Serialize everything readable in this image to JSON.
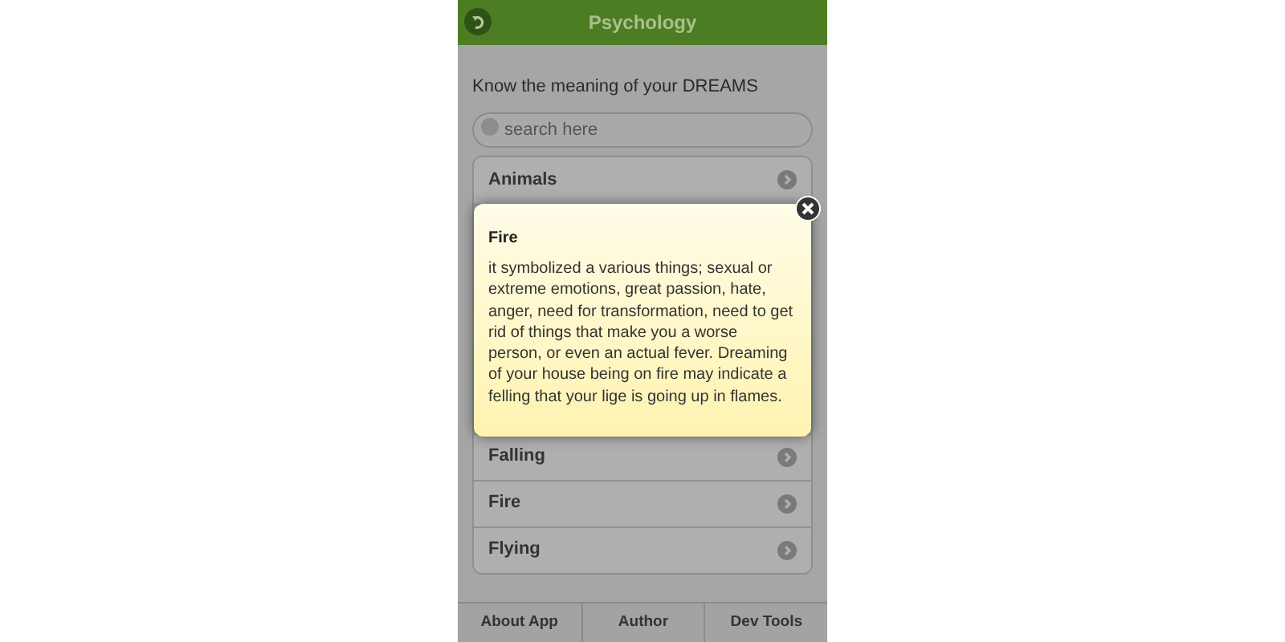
{
  "header": {
    "title": "Psychology"
  },
  "intro": "Know the meaning of your DREAMS",
  "search": {
    "placeholder": "search here"
  },
  "list": {
    "top_items": [
      "Animals"
    ],
    "bottom_items": [
      "Falling",
      "Fire",
      "Flying"
    ]
  },
  "popup": {
    "title": "Fire",
    "body": "it symbolized a various things; sexual or extreme emotions, great passion, hate, anger, need for transformation, need to get rid of things that make you a worse person, or even an actual fever. Dreaming of your house being on fire may indicate a felling that your lige is going up in flames."
  },
  "footer_tabs": [
    {
      "label": "About App"
    },
    {
      "label": "Author"
    },
    {
      "label": "Dev Tools"
    }
  ]
}
